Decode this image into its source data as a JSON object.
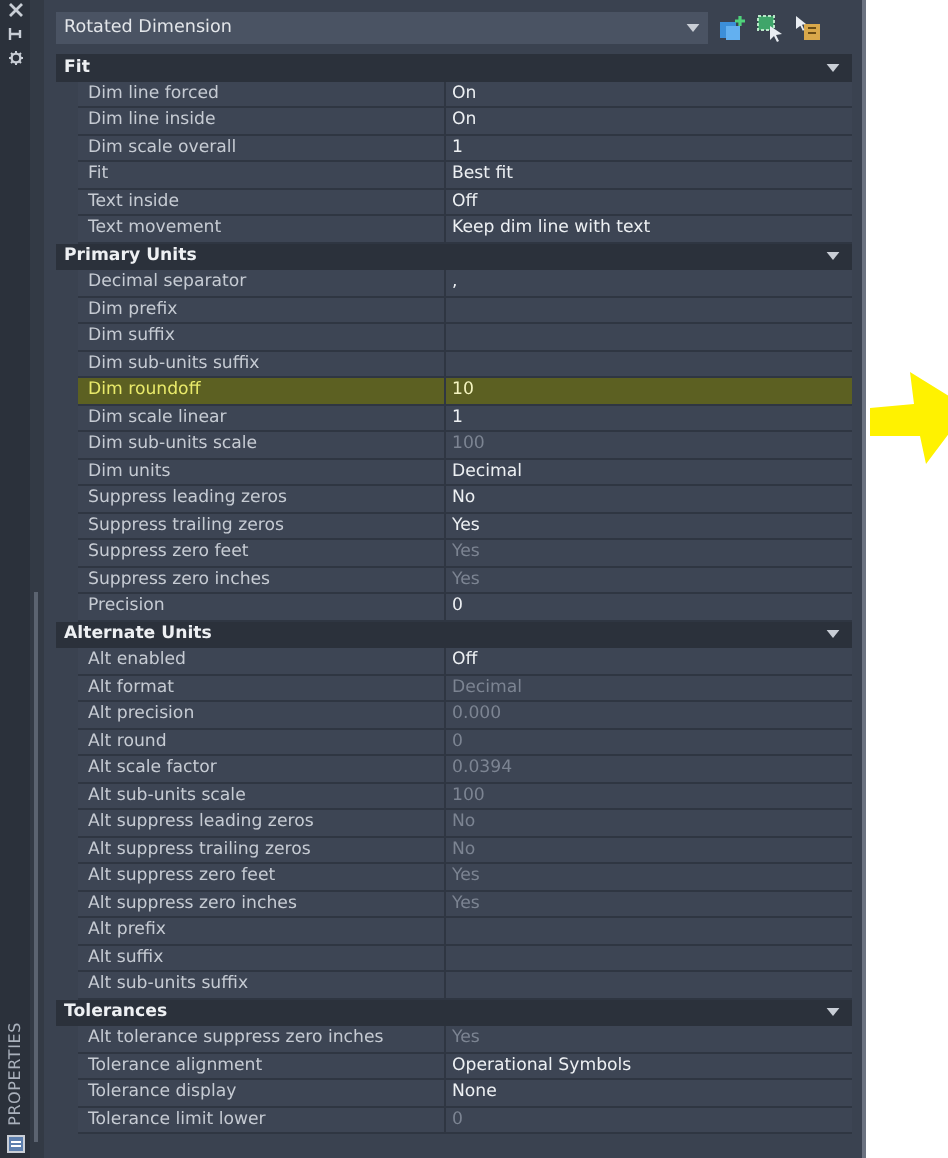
{
  "side_strip": {
    "label": "PROPERTIES"
  },
  "selector": {
    "value": "Rotated Dimension"
  },
  "sections": [
    {
      "title": "Fit",
      "rows": [
        {
          "label": "Dim line forced",
          "value": "On",
          "disabled": false,
          "highlighted": false
        },
        {
          "label": "Dim line inside",
          "value": "On",
          "disabled": false,
          "highlighted": false
        },
        {
          "label": "Dim scale overall",
          "value": "1",
          "disabled": false,
          "highlighted": false
        },
        {
          "label": "Fit",
          "value": "Best fit",
          "disabled": false,
          "highlighted": false
        },
        {
          "label": "Text inside",
          "value": "Off",
          "disabled": false,
          "highlighted": false
        },
        {
          "label": "Text movement",
          "value": "Keep dim line with text",
          "disabled": false,
          "highlighted": false
        }
      ]
    },
    {
      "title": "Primary Units",
      "rows": [
        {
          "label": "Decimal separator",
          "value": ",",
          "disabled": false,
          "highlighted": false
        },
        {
          "label": "Dim prefix",
          "highlighted": false
        },
        {
          "label": "Dim suffix",
          "highlighted": false
        },
        {
          "label": "Dim sub-units suffix",
          "highlighted": false
        },
        {
          "label": "Dim roundoff",
          "value": "10",
          "disabled": false,
          "highlighted": true
        },
        {
          "label": "Dim scale linear",
          "value": "1",
          "disabled": false,
          "highlighted": false
        },
        {
          "label": "Dim sub-units scale",
          "value": "100",
          "disabled": true,
          "highlighted": false
        },
        {
          "label": "Dim units",
          "value": "Decimal",
          "disabled": false,
          "highlighted": false
        },
        {
          "label": "Suppress leading zeros",
          "value": "No",
          "disabled": false,
          "highlighted": false
        },
        {
          "label": "Suppress trailing zeros",
          "value": "Yes",
          "disabled": false,
          "highlighted": false
        },
        {
          "label": "Suppress zero feet",
          "value": "Yes",
          "disabled": true,
          "highlighted": false
        },
        {
          "label": "Suppress zero inches",
          "value": "Yes",
          "disabled": true,
          "highlighted": false
        },
        {
          "label": "Precision",
          "value": "0",
          "disabled": false,
          "highlighted": false
        }
      ]
    },
    {
      "title": "Alternate Units",
      "rows": [
        {
          "label": "Alt enabled",
          "value": "Off",
          "disabled": false,
          "highlighted": false
        },
        {
          "label": "Alt format",
          "value": "Decimal",
          "disabled": true,
          "highlighted": false
        },
        {
          "label": "Alt precision",
          "value": "0.000",
          "disabled": true,
          "highlighted": false
        },
        {
          "label": "Alt round",
          "value": "0",
          "disabled": true,
          "highlighted": false
        },
        {
          "label": "Alt scale factor",
          "value": "0.0394",
          "disabled": true,
          "highlighted": false
        },
        {
          "label": "Alt sub-units scale",
          "value": "100",
          "disabled": true,
          "highlighted": false
        },
        {
          "label": "Alt suppress leading zeros",
          "value": "No",
          "disabled": true,
          "highlighted": false
        },
        {
          "label": "Alt suppress trailing zeros",
          "value": "No",
          "disabled": true,
          "highlighted": false
        },
        {
          "label": "Alt suppress zero feet",
          "value": "Yes",
          "disabled": true,
          "highlighted": false
        },
        {
          "label": "Alt suppress zero inches",
          "value": "Yes",
          "disabled": true,
          "highlighted": false
        },
        {
          "label": "Alt prefix",
          "highlighted": false
        },
        {
          "label": "Alt suffix",
          "highlighted": false
        },
        {
          "label": "Alt sub-units suffix",
          "highlighted": false
        }
      ]
    },
    {
      "title": "Tolerances",
      "rows": [
        {
          "label": "Alt tolerance suppress zero inches",
          "value": "Yes",
          "disabled": true,
          "highlighted": false
        },
        {
          "label": "Tolerance alignment",
          "value": "Operational Symbols",
          "disabled": false,
          "highlighted": false
        },
        {
          "label": "Tolerance display",
          "value": "None",
          "disabled": false,
          "highlighted": false
        },
        {
          "label": "Tolerance limit lower",
          "value": "0",
          "disabled": true,
          "highlighted": false
        }
      ]
    }
  ]
}
